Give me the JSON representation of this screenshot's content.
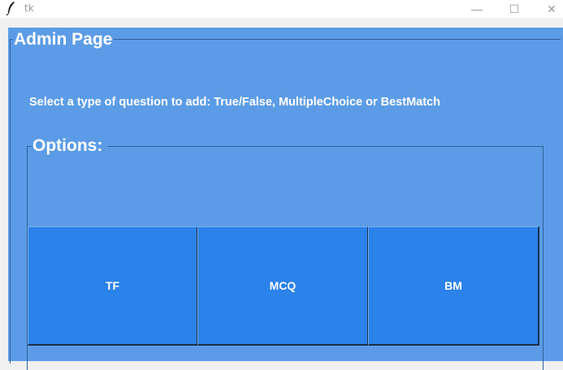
{
  "window": {
    "title": "tk",
    "minimize_glyph": "—",
    "maximize_glyph": "☐",
    "close_glyph": "✕"
  },
  "admin_frame": {
    "label": "Admin Page",
    "instructions": "Select a type of question to add: True/False, MultipleChoice or BestMatch"
  },
  "options_frame": {
    "label": "Options:",
    "buttons": [
      {
        "label": "TF"
      },
      {
        "label": "MCQ"
      },
      {
        "label": "BM"
      }
    ]
  },
  "colors": {
    "panel_background": "#5c9ce6",
    "button_background": "#2b82ea",
    "text": "#ffffff"
  },
  "icons": {
    "app_icon": "feather-icon"
  }
}
